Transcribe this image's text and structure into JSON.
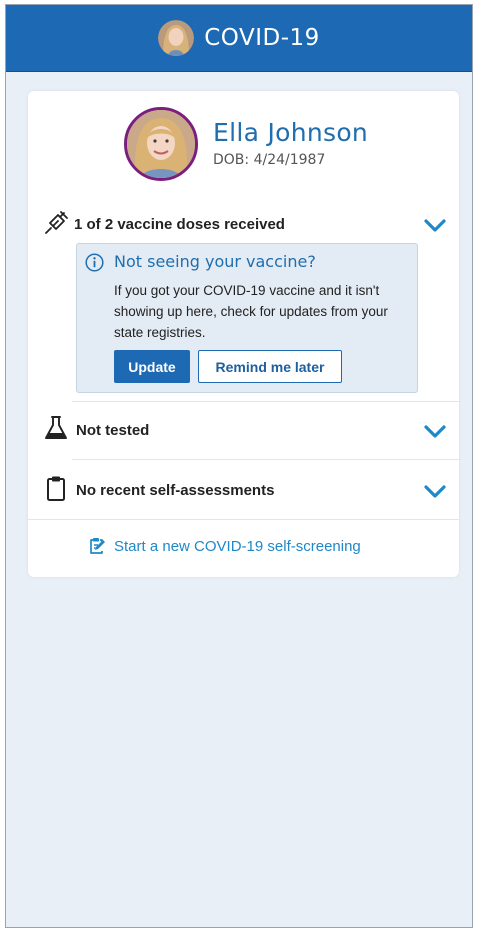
{
  "header": {
    "title": "COVID-19",
    "avatar_icon": "avatar"
  },
  "patient": {
    "name": "Ella Johnson",
    "dob": "DOB: 4/24/1987"
  },
  "sections": {
    "vaccine": {
      "label": "1 of 2 vaccine doses received",
      "icon": "syringe-icon",
      "expanded": true
    },
    "testing": {
      "label": "Not tested",
      "icon": "flask-icon"
    },
    "assessment": {
      "label": "No recent self-assessments",
      "icon": "clipboard-icon"
    }
  },
  "notice": {
    "title": "Not seeing your vaccine?",
    "body": "If you got your COVID-19 vaccine and it isn't showing up here, check for updates from your state registries.",
    "update_label": "Update",
    "remind_label": "Remind me later"
  },
  "start_screening": {
    "label": "Start a new COVID-19 self-screening",
    "icon": "edit-clipboard-icon"
  },
  "colors": {
    "brand": "#1e69b3",
    "avatar_ring": "#7b1f7f",
    "link": "#1e88c8",
    "chevron": "#1e88c8"
  }
}
